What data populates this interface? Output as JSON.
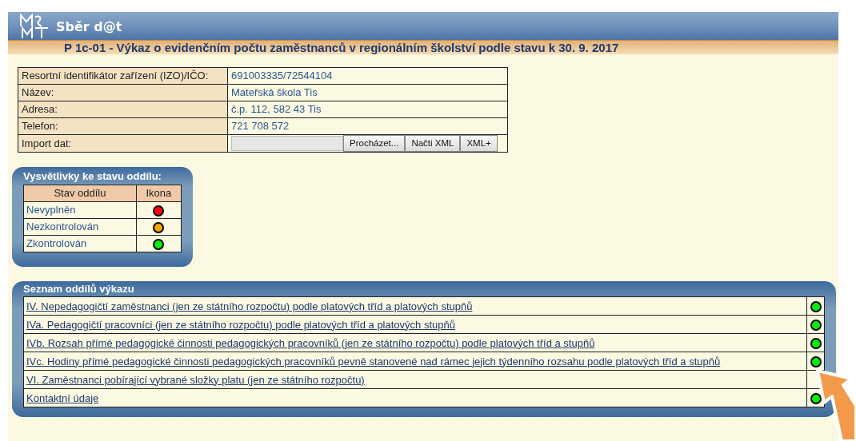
{
  "header": {
    "logo_text": "Sběr d@t",
    "title": "P 1c-01 - Výkaz o evidenčním počtu zaměstnanců v regionálním školství podle stavu k 30. 9. 2017"
  },
  "info": [
    {
      "label": "Resortní identifikátor zařízení (IZO)/IČO:",
      "value": "691003335/72544104"
    },
    {
      "label": "Název:",
      "value": "Mateřská škola Tis"
    },
    {
      "label": "Adresa:",
      "value": "č.p. 112, 582 43 Tis"
    },
    {
      "label": "Telefon:",
      "value": "721 708 572"
    }
  ],
  "import": {
    "label": "Import dat:",
    "buttons": [
      "Procházet...",
      "Načti XML",
      "XML+"
    ]
  },
  "legend": {
    "title": "Vysvětlivky ke stavu oddílu:",
    "columns": [
      "Stav oddílu",
      "Ikona"
    ],
    "rows": [
      {
        "label": "Nevyplněn",
        "color": "#ff0000"
      },
      {
        "label": "Nezkontrolován",
        "color": "#ffa500"
      },
      {
        "label": "Zkontrolován",
        "color": "#00ee00"
      }
    ]
  },
  "sections": {
    "title": "Seznam oddílů výkazu",
    "items": [
      {
        "label": "IV. Nepedagogičtí zaměstnanci (jen ze státního rozpočtu) podle platových tříd a platových stupňů",
        "color": "#00ee00"
      },
      {
        "label": "IVa. Pedagogičtí pracovníci (jen ze státního rozpočtu) podle platových tříd a platových stupňů",
        "color": "#00ee00"
      },
      {
        "label": "IVb. Rozsah přímé pedagogické činnosti pedagogických pracovníků (jen ze státního rozpočtu) podle platových tříd a stupňů",
        "color": "#00ee00"
      },
      {
        "label": "IVc. Hodiny přímé pedagogické činnosti pedagogických pracovníků pevně stanovené nad rámec jejich týdenního rozsahu podle platových tříd a stupňů",
        "color": "#00ee00"
      },
      {
        "label": "VI. Zaměstnanci pobírající vybrané složky platu (jen ze státního rozpočtu)"
      },
      {
        "label": "Kontaktní údaje",
        "color": "#00ee00"
      }
    ]
  }
}
